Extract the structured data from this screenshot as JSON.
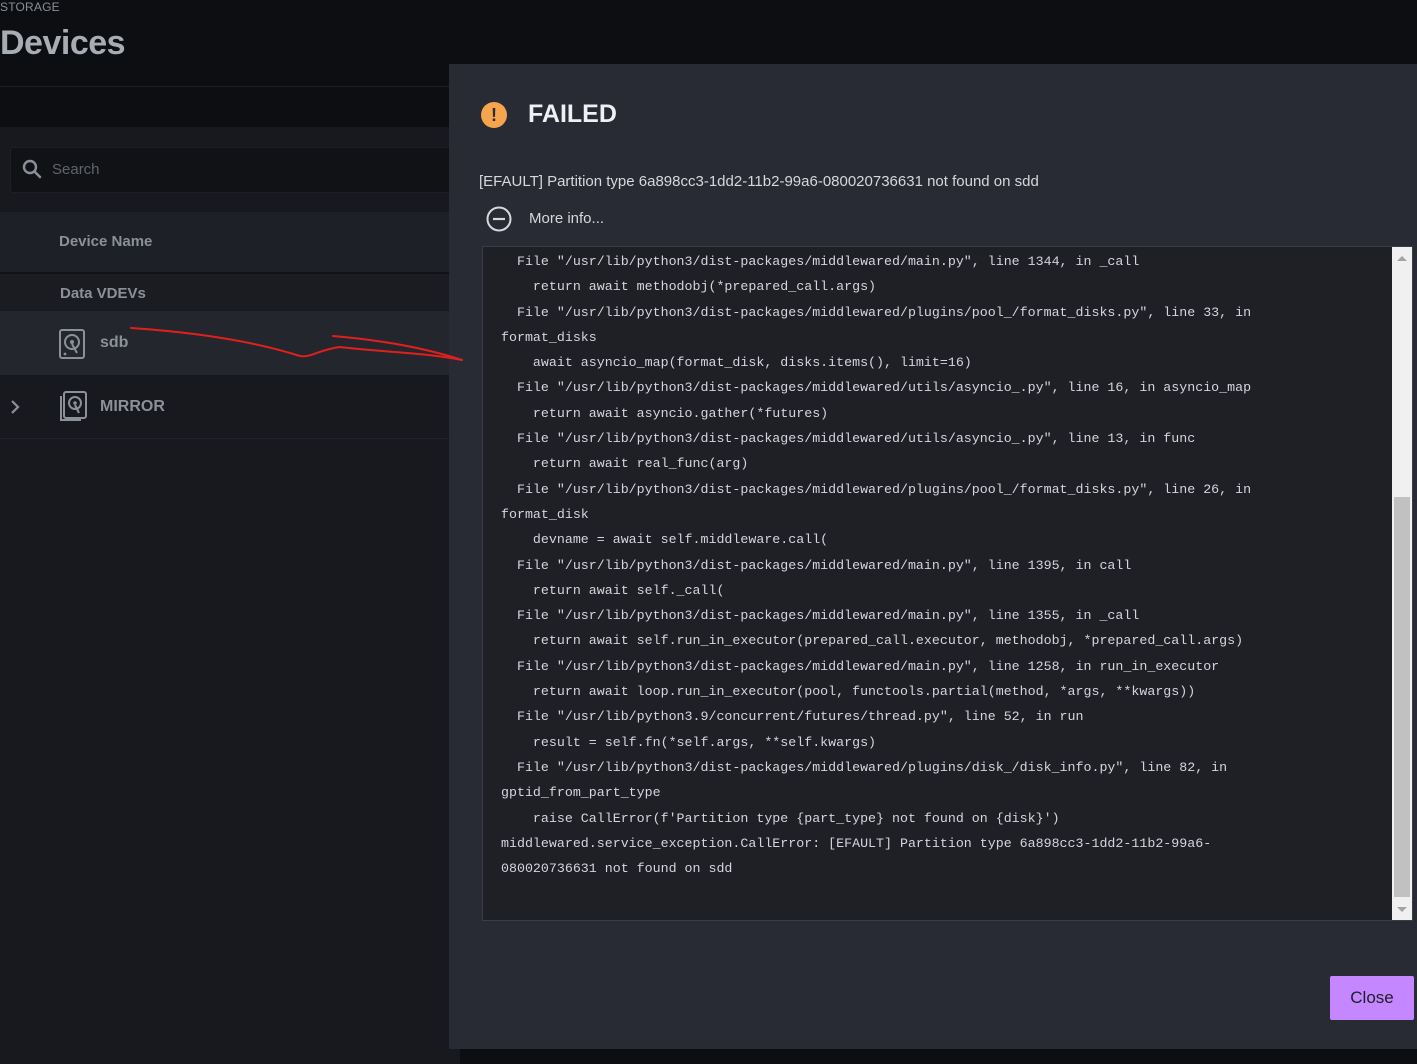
{
  "header": {
    "breadcrumb": "STORAGE",
    "title": "Devices"
  },
  "search": {
    "placeholder": "Search",
    "value": ""
  },
  "table": {
    "column_device_name": "Device Name",
    "group_label": "Data VDEVs",
    "rows": [
      {
        "label": "sdb",
        "icon": "hard-disk-icon"
      },
      {
        "label": "MIRROR",
        "icon": "mirror-disks-icon",
        "expandable": true
      }
    ]
  },
  "dialog": {
    "title": "FAILED",
    "status_icon": "warning-icon",
    "message": "[EFAULT] Partition type 6a898cc3-1dd2-11b2-99a6-080020736631 not found on sdd",
    "more_info_label": "More info...",
    "traceback": "  File \"/usr/lib/python3/dist-packages/middlewared/main.py\", line 1344, in _call\n    return await methodobj(*prepared_call.args)\n  File \"/usr/lib/python3/dist-packages/middlewared/plugins/pool_/format_disks.py\", line 33, in\nformat_disks\n    await asyncio_map(format_disk, disks.items(), limit=16)\n  File \"/usr/lib/python3/dist-packages/middlewared/utils/asyncio_.py\", line 16, in asyncio_map\n    return await asyncio.gather(*futures)\n  File \"/usr/lib/python3/dist-packages/middlewared/utils/asyncio_.py\", line 13, in func\n    return await real_func(arg)\n  File \"/usr/lib/python3/dist-packages/middlewared/plugins/pool_/format_disks.py\", line 26, in\nformat_disk\n    devname = await self.middleware.call(\n  File \"/usr/lib/python3/dist-packages/middlewared/main.py\", line 1395, in call\n    return await self._call(\n  File \"/usr/lib/python3/dist-packages/middlewared/main.py\", line 1355, in _call\n    return await self.run_in_executor(prepared_call.executor, methodobj, *prepared_call.args)\n  File \"/usr/lib/python3/dist-packages/middlewared/main.py\", line 1258, in run_in_executor\n    return await loop.run_in_executor(pool, functools.partial(method, *args, **kwargs))\n  File \"/usr/lib/python3.9/concurrent/futures/thread.py\", line 52, in run\n    result = self.fn(*self.args, **self.kwargs)\n  File \"/usr/lib/python3/dist-packages/middlewared/plugins/disk_/disk_info.py\", line 82, in\ngptid_from_part_type\n    raise CallError(f'Partition type {part_type} not found on {disk}')\nmiddlewared.service_exception.CallError: [EFAULT] Partition type 6a898cc3-1dd2-11b2-99a6-\n080020736631 not found on sdd",
    "close_label": "Close"
  },
  "colors": {
    "accent_button": "#c487ff",
    "warning": "#f6a54d",
    "annotation_stroke": "#e0201c"
  }
}
